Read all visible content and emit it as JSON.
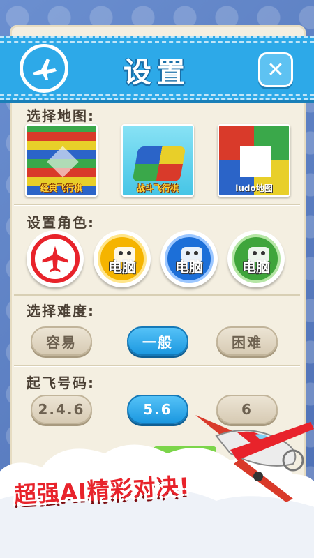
{
  "header": {
    "title": "设置"
  },
  "sections": {
    "map": {
      "label": "选择地图:",
      "maps": [
        {
          "caption": "经典飞行棋"
        },
        {
          "caption": "战斗飞行棋"
        },
        {
          "caption": "ludo地图"
        }
      ]
    },
    "roles": {
      "label": "设置角色:",
      "items": [
        {
          "label": "",
          "color": "#e8232b",
          "icon": "airplane-icon"
        },
        {
          "label": "电脑",
          "color": "#f5b400",
          "icon": "robot-icon"
        },
        {
          "label": "电脑",
          "color": "#1c6fd8",
          "icon": "robot-icon"
        },
        {
          "label": "电脑",
          "color": "#3fa53b",
          "icon": "robot-icon"
        }
      ]
    },
    "difficulty": {
      "label": "选择难度:",
      "options": [
        "容易",
        "一般",
        "困难"
      ],
      "selected": "一般"
    },
    "takeoff": {
      "label": "起飞号码:",
      "options": [
        "2.4.6",
        "5.6",
        "6"
      ],
      "selected": "5.6"
    }
  },
  "promo": {
    "text": "超强AI精彩对决!"
  },
  "colors": {
    "accent": "#2da9e8",
    "panel": "#f4efe1",
    "promo": "#e8232b"
  }
}
